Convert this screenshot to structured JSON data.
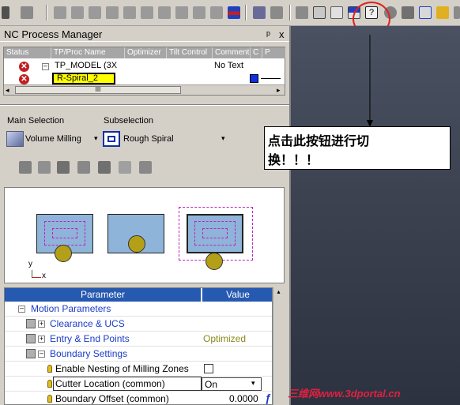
{
  "panel": {
    "title": "NC Process Manager",
    "pin": "ᵖ",
    "close": "x"
  },
  "tree": {
    "columns": [
      "Status",
      "TP/Proc Name",
      "Optimizer",
      "Tilt Control",
      "Comment",
      "C",
      "P"
    ],
    "rows": [
      {
        "name": "TP_MODEL (3X",
        "comment": "No Text"
      },
      {
        "name": "R-Spiral_2"
      }
    ],
    "scroll_thumb": "III"
  },
  "selection": {
    "main_label": "Main Selection",
    "sub_label": "Subselection",
    "main_value": "Volume Milling",
    "sub_value": "Rough Spiral"
  },
  "grid": {
    "header_parameter": "Parameter",
    "header_value": "Value",
    "rows": [
      {
        "label": "Motion Parameters",
        "value": ""
      },
      {
        "label": "Clearance & UCS",
        "value": ""
      },
      {
        "label": "Entry & End Points",
        "value": "Optimized"
      },
      {
        "label": "Boundary Settings",
        "value": ""
      },
      {
        "label": "Enable Nesting of Milling Zones",
        "value": ""
      },
      {
        "label": "Cutter Location (common)",
        "value": "On"
      },
      {
        "label": "Boundary Offset (common)",
        "value": "0.0000"
      }
    ],
    "formula_glyph": "ƒ"
  },
  "annotation": {
    "line1": "点击此按钮进行切",
    "line2": "换！！！"
  },
  "watermark": "三维网www.3dportal.cn",
  "axes": {
    "y": "y",
    "x": "x"
  },
  "colors": {
    "header_blue": "#2659b0",
    "value_olive": "#8a8a1e",
    "highlight_yellow": "#ffff00",
    "callout_red": "#e02020"
  }
}
